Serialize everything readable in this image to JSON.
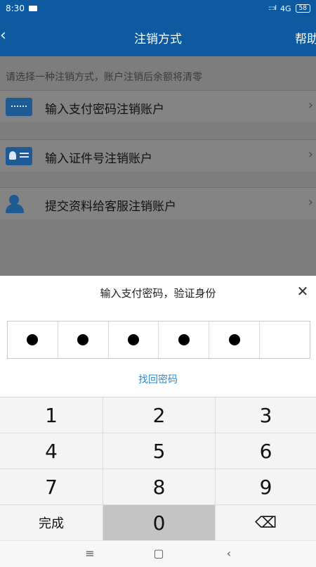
{
  "status": {
    "time": "8:30",
    "signal": "::::ıl",
    "network": "4G",
    "battery": "58"
  },
  "header": {
    "back_icon": "‹",
    "title": "注销方式",
    "help": "帮助"
  },
  "content": {
    "hint": "请选择一种注销方式，账户注销后余额将清零",
    "options": [
      {
        "icon": "card-icon",
        "label": "输入支付密码注销账户"
      },
      {
        "icon": "id-card-icon",
        "label": "输入证件号注销账户"
      },
      {
        "icon": "user-service-icon",
        "label": "提交资料给客服注销账户"
      }
    ]
  },
  "sheet": {
    "title": "输入支付密码，验证身份",
    "close": "✕",
    "pin_entered": 5,
    "pin_length": 6,
    "forgot": "找回密码"
  },
  "keypad": {
    "keys": [
      "1",
      "2",
      "3",
      "4",
      "5",
      "6",
      "7",
      "8",
      "9",
      "完成",
      "0",
      "⌫"
    ]
  },
  "navbar": {
    "menu": "≡",
    "home": "▢",
    "back": "‹"
  }
}
